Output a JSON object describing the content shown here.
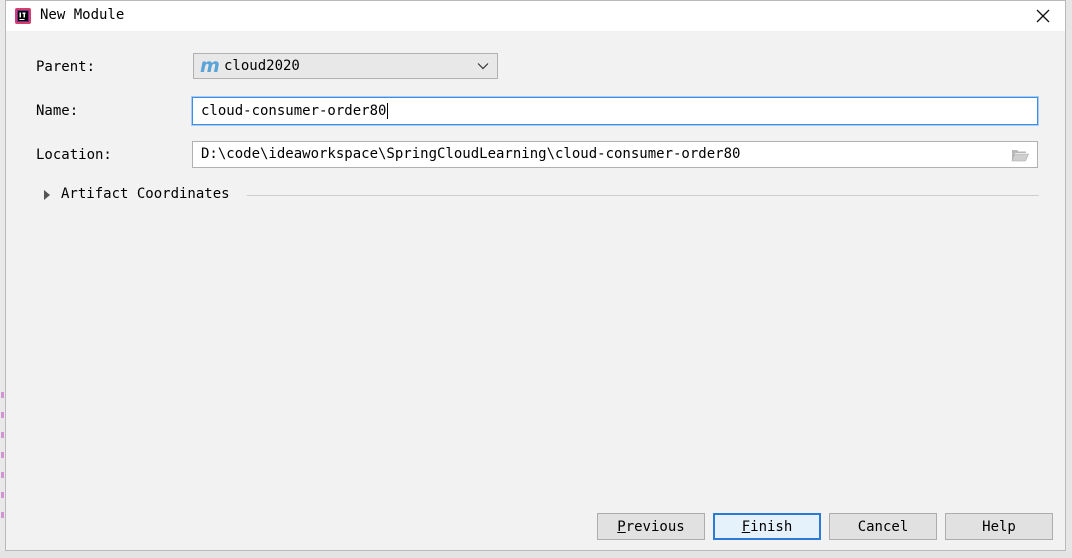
{
  "window": {
    "title": "New Module"
  },
  "form": {
    "parent": {
      "label": "Parent:",
      "value": "cloud2020",
      "icon": "maven-m-icon"
    },
    "name": {
      "label": "Name:",
      "value": "cloud-consumer-order80"
    },
    "location": {
      "label": "Location:",
      "value": "D:\\code\\ideaworkspace\\SpringCloudLearning\\cloud-consumer-order80"
    }
  },
  "sections": {
    "artifact": {
      "title": "Artifact Coordinates",
      "expanded": false
    }
  },
  "buttons": {
    "previous": {
      "mnemonic": "P",
      "rest": "revious"
    },
    "finish": {
      "mnemonic": "F",
      "rest": "inish"
    },
    "cancel": {
      "label": "Cancel"
    },
    "help": {
      "label": "Help"
    }
  },
  "colors": {
    "accent": "#2b7bd6",
    "maven_icon": "#5ba4d8",
    "dialog_bg": "#f2f2f2"
  }
}
